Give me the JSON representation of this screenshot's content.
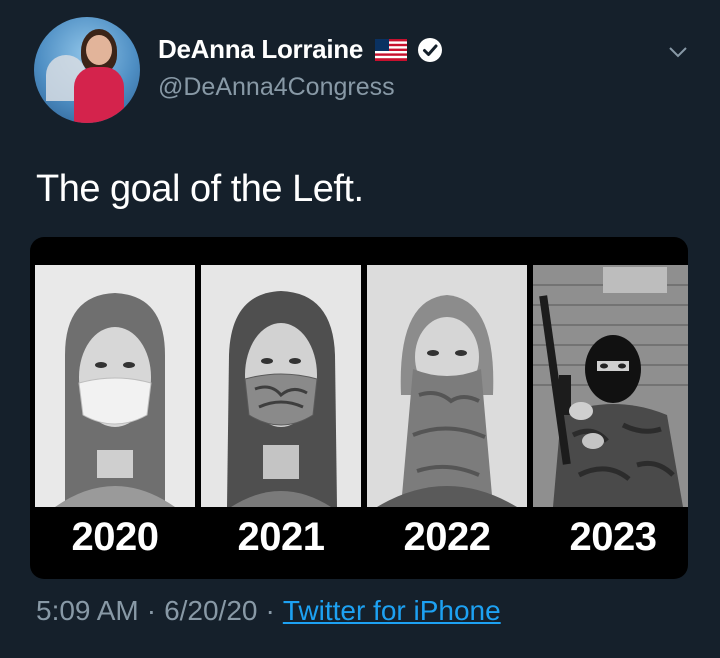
{
  "account": {
    "display_name": "DeAnna Lorraine",
    "handle": "@DeAnna4Congress",
    "badge_icon": "verified-badge-icon",
    "flag_icon": "us-flag-icon"
  },
  "tweet": {
    "text": "The goal of the Left.",
    "time": "5:09 AM",
    "separator": "·",
    "date": "6/20/20",
    "source": "Twitter for iPhone"
  },
  "media": {
    "years": [
      "2020",
      "2021",
      "2022",
      "2023"
    ]
  },
  "colors": {
    "background": "#15202b",
    "secondary_text": "#8899a6",
    "link": "#1da1f2"
  }
}
